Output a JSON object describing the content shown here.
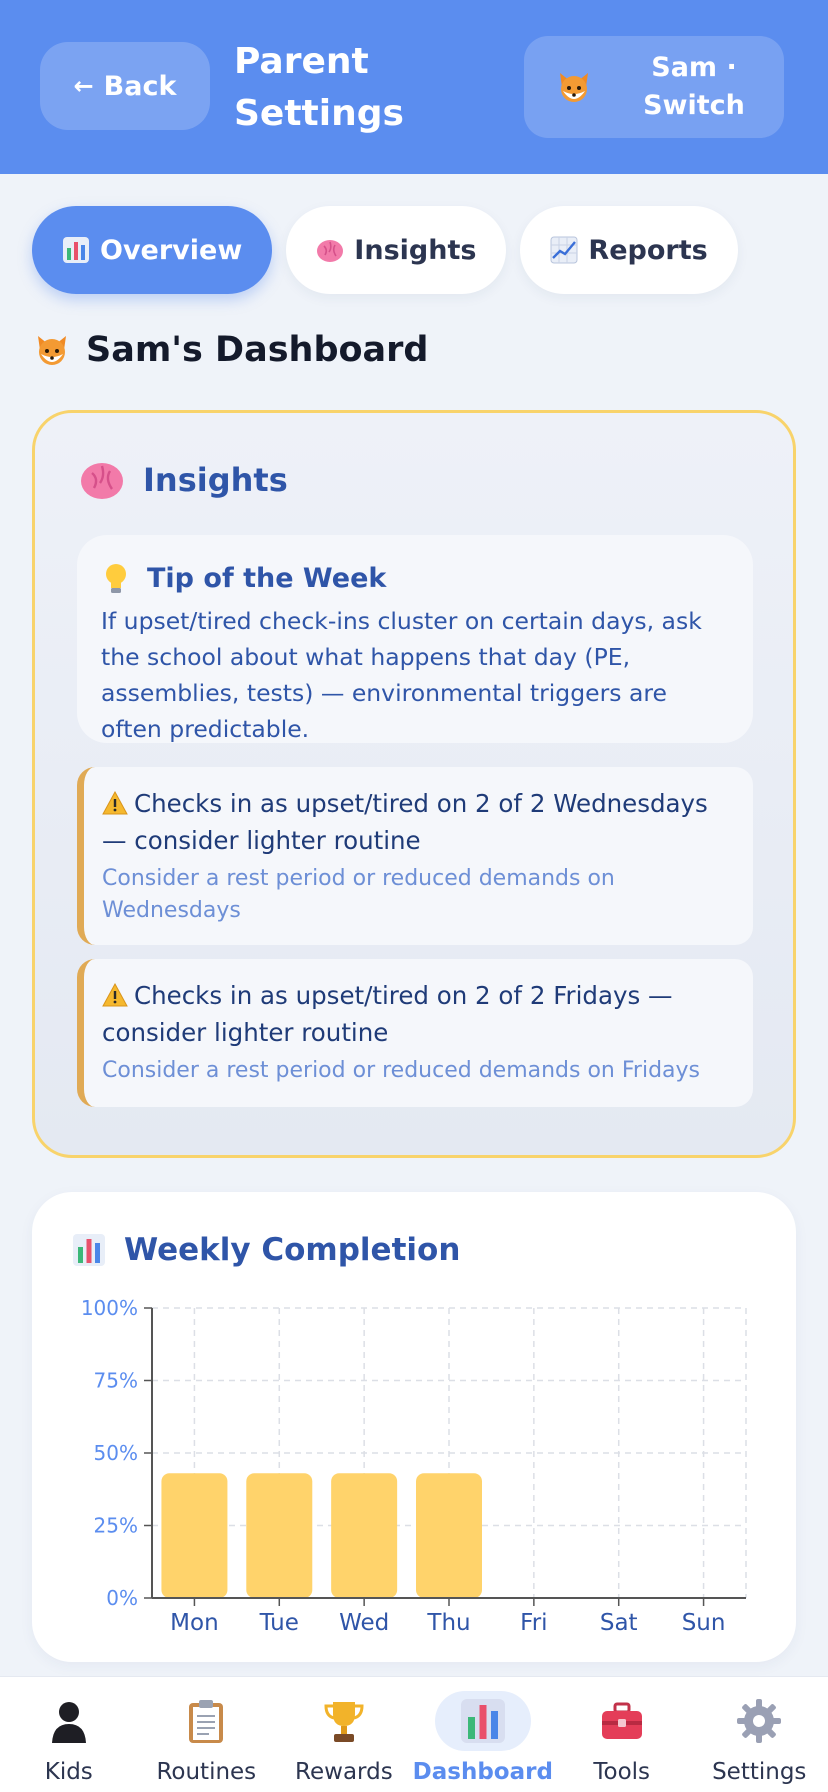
{
  "header": {
    "back_label": "Back",
    "title": "Parent Settings",
    "switch_label": "Sam · Switch"
  },
  "tabs": [
    {
      "label": "Overview",
      "icon": "bar-chart-icon",
      "active": true
    },
    {
      "label": "Insights",
      "icon": "brain-icon",
      "active": false
    },
    {
      "label": "Reports",
      "icon": "trend-chart-icon",
      "active": false
    }
  ],
  "dashboard": {
    "title": "Sam's Dashboard",
    "avatar_icon": "fox-icon"
  },
  "insights": {
    "heading": "Insights",
    "tip": {
      "title": "Tip of the Week",
      "text": "If upset/tired check-ins cluster on certain days, ask the school about what happens that day (PE, assemblies, tests) — environmental triggers are often predictable."
    },
    "alerts": [
      {
        "title": "Checks in as upset/tired on 2 of 2 Wednesdays — consider lighter routine",
        "suggestion": "Consider a rest period or reduced demands on Wednesdays"
      },
      {
        "title": "Checks in as upset/tired on 2 of 2 Fridays — consider lighter routine",
        "suggestion": "Consider a rest period or reduced demands on Fridays"
      }
    ]
  },
  "weekly": {
    "title": "Weekly Completion"
  },
  "chart_data": {
    "type": "bar",
    "title": "Weekly Completion",
    "categories": [
      "Mon",
      "Tue",
      "Wed",
      "Thu",
      "Fri",
      "Sat",
      "Sun"
    ],
    "values": [
      43,
      43,
      43,
      43,
      0,
      0,
      0
    ],
    "yticks": [
      "0%",
      "25%",
      "50%",
      "75%",
      "100%"
    ],
    "ylim": [
      0,
      100
    ],
    "grid": true,
    "bar_color": "#ffd36b"
  },
  "bottom_nav": [
    {
      "label": "Kids",
      "icon": "kid-silhouette-icon",
      "active": false
    },
    {
      "label": "Routines",
      "icon": "clipboard-icon",
      "active": false
    },
    {
      "label": "Rewards",
      "icon": "trophy-icon",
      "active": false
    },
    {
      "label": "Dashboard",
      "icon": "bar-chart-icon",
      "active": true
    },
    {
      "label": "Tools",
      "icon": "toolbox-icon",
      "active": false
    },
    {
      "label": "Settings",
      "icon": "gear-icon",
      "active": false
    }
  ],
  "colors": {
    "accent": "#5b8def",
    "highlight_border": "#f8d36b",
    "alert_border": "#e0aa55",
    "insight_text": "#2f55a8"
  }
}
